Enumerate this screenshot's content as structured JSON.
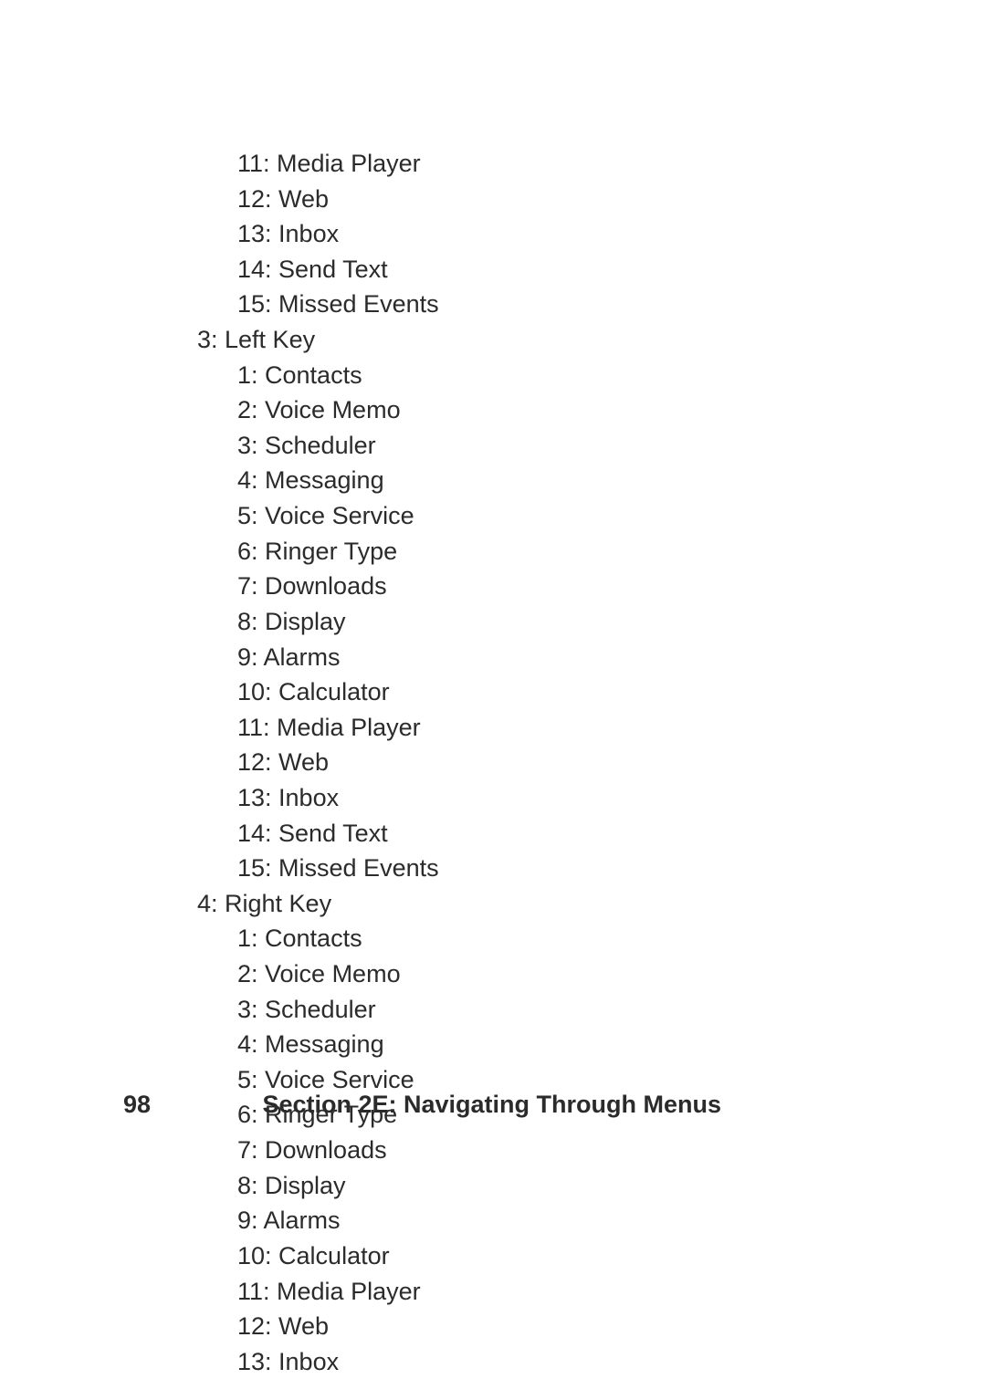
{
  "menu": {
    "top_items": [
      "11: Media Player",
      "12: Web",
      "13: Inbox",
      "14: Send Text",
      "15: Missed Events"
    ],
    "section_3_label": "3: Left Key",
    "section_3_items": [
      "1: Contacts",
      "2: Voice Memo",
      "3: Scheduler",
      "4: Messaging",
      "5: Voice Service",
      "6: Ringer Type",
      "7: Downloads",
      "8: Display",
      "9: Alarms",
      "10: Calculator",
      "11: Media Player",
      "12: Web",
      "13: Inbox",
      "14: Send Text",
      "15: Missed Events"
    ],
    "section_4_label": "4: Right Key",
    "section_4_items": [
      "1: Contacts",
      "2: Voice Memo",
      "3: Scheduler",
      "4: Messaging",
      "5: Voice Service",
      "6: Ringer Type",
      "7: Downloads",
      "8: Display",
      "9: Alarms",
      "10: Calculator",
      "11: Media Player",
      "12: Web",
      "13: Inbox"
    ]
  },
  "footer": {
    "page_number": "98",
    "section_title": "Section 2E: Navigating Through Menus"
  }
}
